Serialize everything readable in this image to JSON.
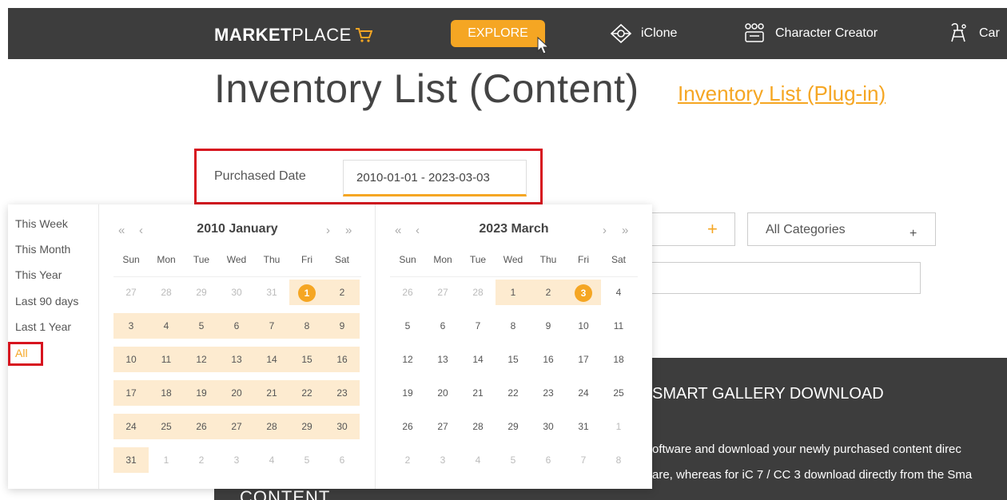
{
  "nav": {
    "logo_bold": "MARKET",
    "logo_thin": "PLACE",
    "explore": "EXPLORE",
    "items": [
      {
        "label": "iClone",
        "icon": "iclone-icon"
      },
      {
        "label": "Character Creator",
        "icon": "character-creator-icon"
      },
      {
        "label": "Car",
        "icon": "cartoon-animator-icon"
      }
    ]
  },
  "page": {
    "title": "Inventory List (Content)",
    "plugin_link": "Inventory List (Plug-in)"
  },
  "date_filter": {
    "label": "Purchased Date",
    "value": "2010-01-01  - 2023-03-03"
  },
  "filters": {
    "categories": "All Categories"
  },
  "smart_gallery": {
    "title": "SMART GALLERY DOWNLOAD",
    "line1": "oftware and download your newly purchased content direc",
    "line2": "are, whereas for iC 7 / CC 3 download directly from the Sma",
    "content_heading": "CONTENT"
  },
  "picker": {
    "quick_ranges": [
      "This Week",
      "This Month",
      "This Year",
      "Last 90 days",
      "Last 1 Year",
      "All"
    ],
    "active_quick_range": "All",
    "weekdays": [
      "Sun",
      "Mon",
      "Tue",
      "Wed",
      "Thu",
      "Fri",
      "Sat"
    ],
    "arrows": {
      "prev_year": "«",
      "prev_month": "‹",
      "next_month": "›",
      "next_year": "»"
    },
    "months": [
      {
        "title": "2010 January",
        "days": [
          [
            "27",
            "28",
            "29",
            "30",
            "31",
            "1",
            "2"
          ],
          [
            "3",
            "4",
            "5",
            "6",
            "7",
            "8",
            "9"
          ],
          [
            "10",
            "11",
            "12",
            "13",
            "14",
            "15",
            "16"
          ],
          [
            "17",
            "18",
            "19",
            "20",
            "21",
            "22",
            "23"
          ],
          [
            "24",
            "25",
            "26",
            "27",
            "28",
            "29",
            "30"
          ],
          [
            "31",
            "1",
            "2",
            "3",
            "4",
            "5",
            "6"
          ]
        ],
        "current_from": [
          0,
          5
        ],
        "current_to": [
          5,
          0
        ],
        "range_from": [
          0,
          5
        ],
        "range_to": [
          5,
          0
        ],
        "selected": [
          0,
          5
        ]
      },
      {
        "title": "2023 March",
        "days": [
          [
            "26",
            "27",
            "28",
            "1",
            "2",
            "3",
            "4"
          ],
          [
            "5",
            "6",
            "7",
            "8",
            "9",
            "10",
            "11"
          ],
          [
            "12",
            "13",
            "14",
            "15",
            "16",
            "17",
            "18"
          ],
          [
            "19",
            "20",
            "21",
            "22",
            "23",
            "24",
            "25"
          ],
          [
            "26",
            "27",
            "28",
            "29",
            "30",
            "31",
            "1"
          ],
          [
            "2",
            "3",
            "4",
            "5",
            "6",
            "7",
            "8"
          ]
        ],
        "current_from": [
          0,
          3
        ],
        "current_to": [
          4,
          5
        ],
        "range_from": [
          0,
          3
        ],
        "range_to": [
          0,
          5
        ],
        "selected": [
          0,
          5
        ]
      }
    ]
  },
  "colors": {
    "accent": "#f5a623",
    "range_fill": "#fdebd0",
    "highlight_red": "#d7141f",
    "topbar": "#3d3d3d"
  }
}
